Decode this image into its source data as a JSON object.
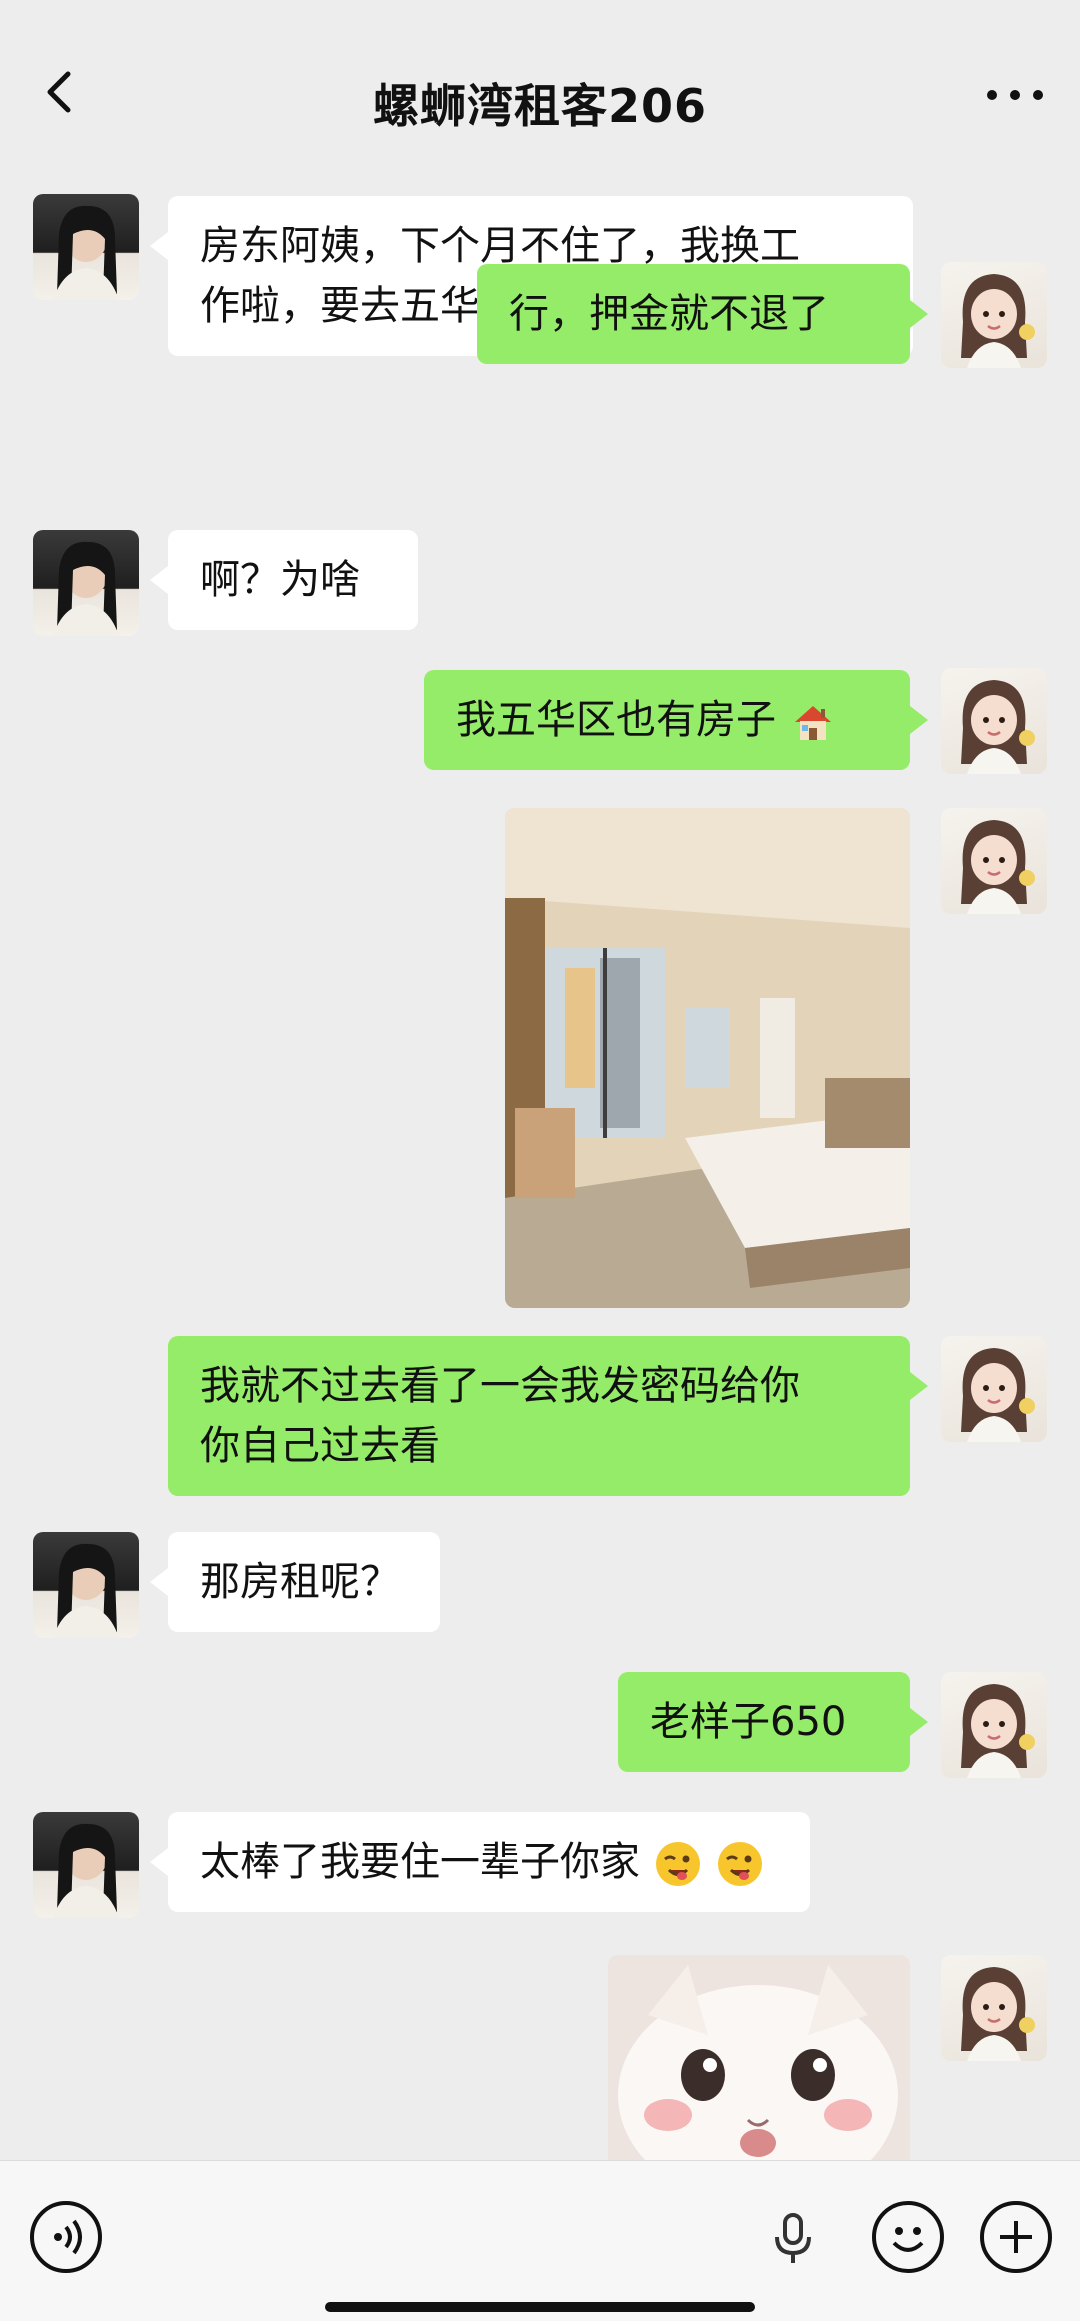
{
  "header": {
    "title": "螺蛳湾租客206"
  },
  "messages": [
    {
      "side": "left",
      "text_line1": "房东阿姨，下个月不住了，我换工",
      "text_line2": "作啦，要去五华那边了"
    },
    {
      "side": "right",
      "text": "行，押金就不退了"
    },
    {
      "side": "left",
      "text": "啊？为啥"
    },
    {
      "side": "right",
      "text": "我五华区也有房子",
      "emoji": "house-emoji"
    },
    {
      "side": "right",
      "type": "image",
      "content": "bedroom-photo"
    },
    {
      "side": "right",
      "text_line1": "我就不过去看了一会我发密码给你",
      "text_line2": "你自己过去看"
    },
    {
      "side": "left",
      "text": "那房租呢？"
    },
    {
      "side": "right",
      "text": "老样子650"
    },
    {
      "side": "left",
      "text": "太棒了我要住一辈子你家",
      "emoji": "winking-face-emoji"
    },
    {
      "side": "right",
      "type": "image",
      "content": "kitten-sticker"
    }
  ],
  "icons": {
    "back": "chevron-left-icon",
    "more": "more-icon",
    "voice": "voice-icon",
    "mic": "mic-icon",
    "emoji": "emoji-icon",
    "add": "plus-icon"
  }
}
